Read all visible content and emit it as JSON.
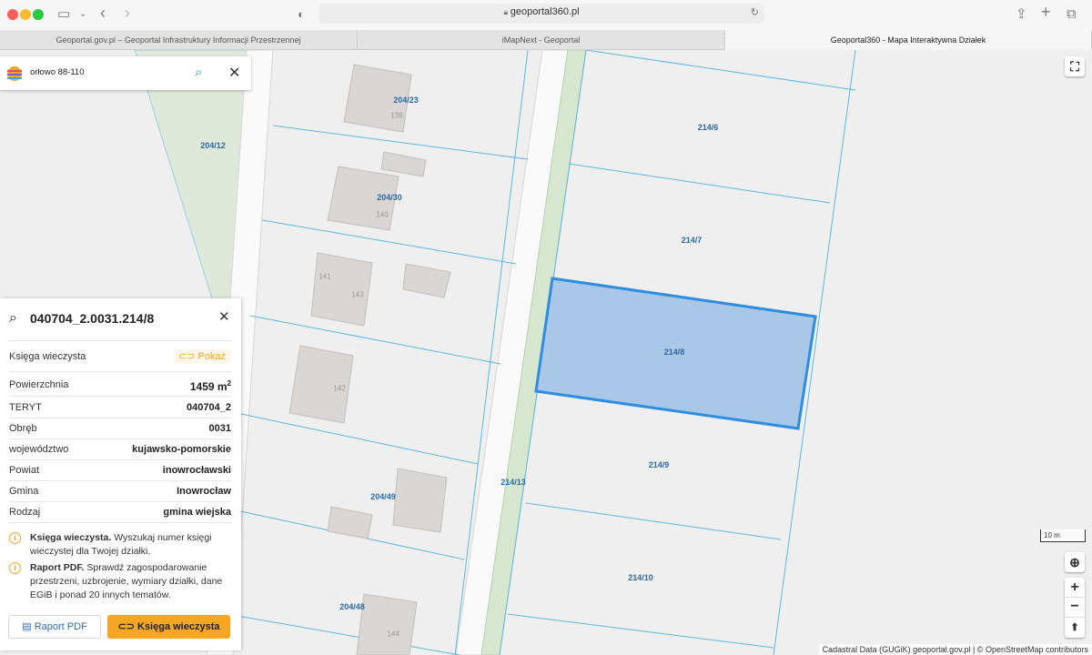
{
  "browser": {
    "url": "geoportal360.pl",
    "tabs": [
      {
        "label": "Geoportal.gov.pl – Geoportal Infrastruktury Informacji Przestrzennej",
        "active": false
      },
      {
        "label": "iMapNext - Geoportal",
        "active": false
      },
      {
        "label": "Geoportal360 - Mapa Interaktywna Działek",
        "active": true
      }
    ]
  },
  "search": {
    "value": "orłowo 88-110"
  },
  "parcels": [
    "204/23",
    "204/12",
    "204/30",
    "214/6",
    "214/7",
    "214/8",
    "214/9",
    "214/10",
    "214/13",
    "204/49",
    "204/48"
  ],
  "buildings": [
    "139",
    "140",
    "141",
    "143",
    "142",
    "144"
  ],
  "selected_parcel": "214/8",
  "panel": {
    "title": "040704_2.0031.214/8",
    "kw_label": "Księga wieczysta",
    "kw_action": "Pokaż",
    "rows": [
      {
        "label": "Powierzchnia",
        "value": "1459 m",
        "sup": "2"
      },
      {
        "label": "TERYT",
        "value": "040704_2"
      },
      {
        "label": "Obręb",
        "value": "0031"
      },
      {
        "label": "województwo",
        "value": "kujawsko-pomorskie"
      },
      {
        "label": "Powiat",
        "value": "inowrocławski"
      },
      {
        "label": "Gmina",
        "value": "Inowrocław"
      },
      {
        "label": "Rodzaj",
        "value": "gmina wiejska"
      }
    ],
    "info1_bold": "Księga wieczysta.",
    "info1_text": " Wyszukaj numer księgi wieczystej dla Twojej działki.",
    "info2_bold": "Raport PDF.",
    "info2_text": " Sprawdź zagospodarowanie przestrzeni, uzbrojenie, wymiary działki, dane EGiB i ponad 20 innych tematów.",
    "btn_pdf": "Raport PDF",
    "btn_kw": "Księga wieczysta"
  },
  "scale": "10 m",
  "attribution": "Cadastral Data (GUGiK) geoportal.gov.pl | © OpenStreetMap contributors",
  "colors": {
    "accent": "#f5a623",
    "parcel_line": "#5bb8e0",
    "parcel_label": "#2c6aa8",
    "selected_fill": "#a9c7e6",
    "selected_stroke": "#2f8de0"
  }
}
